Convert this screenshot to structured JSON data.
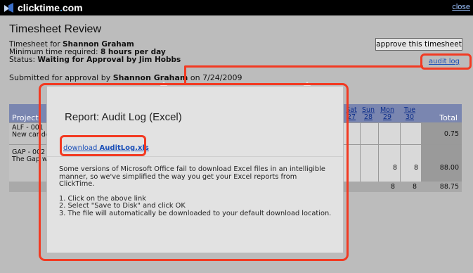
{
  "topbar": {
    "logo_text": "clicktime",
    "logo_dot": ".",
    "logo_suffix": "com",
    "close_label": "close"
  },
  "page": {
    "title": "Timesheet Review",
    "timesheet_for_label": "Timesheet for ",
    "employee": "Shannon Graham",
    "min_time_label": "Minimum time required: ",
    "min_time_value": "8 hours per day",
    "status_label": "Status: ",
    "status_value": "Waiting for Approval by Jim Hobbs",
    "submitted_prefix": "Submitted for approval by ",
    "submitted_name": "Shannon Graham",
    "submitted_on": " on 7/24/2009",
    "approve_button": "approve this timesheet",
    "audit_log_link": "audit log"
  },
  "table": {
    "project_header": "Project",
    "total_header": "Total",
    "day_columns": [
      {
        "day": "Sat",
        "date": "27"
      },
      {
        "day": "Sun",
        "date": "28"
      },
      {
        "day": "Mon",
        "date": "29"
      },
      {
        "day": "Tue",
        "date": "30"
      }
    ],
    "rows": [
      {
        "code": "ALF - 001",
        "name": "New car de",
        "values": [
          "",
          "",
          "",
          ""
        ],
        "total": "0.75"
      },
      {
        "code": "GAP - 002",
        "name": "The Gap w",
        "values": [
          "",
          "",
          "8",
          "8"
        ],
        "total": "88.00"
      }
    ],
    "summary": {
      "values": [
        "",
        "",
        "8",
        "8"
      ],
      "total": "88.75"
    }
  },
  "dialog": {
    "title": "Report: Audit Log (Excel)",
    "download_prefix": "download ",
    "download_file": "AuditLog.xls",
    "body_text": "Some versions of Microsoft Office fail to download Excel files in an intelligible manner, so we've simplified the way you get your Excel reports from ClickTime.",
    "steps": [
      "1. Click on the above link",
      "2. Select \"Save to Disk\" and click OK",
      "3. The file will automatically be downloaded to your default download location."
    ]
  },
  "colors": {
    "highlight": "#f23a22",
    "link": "#1a4fb8",
    "table_header": "#7a86b0"
  }
}
